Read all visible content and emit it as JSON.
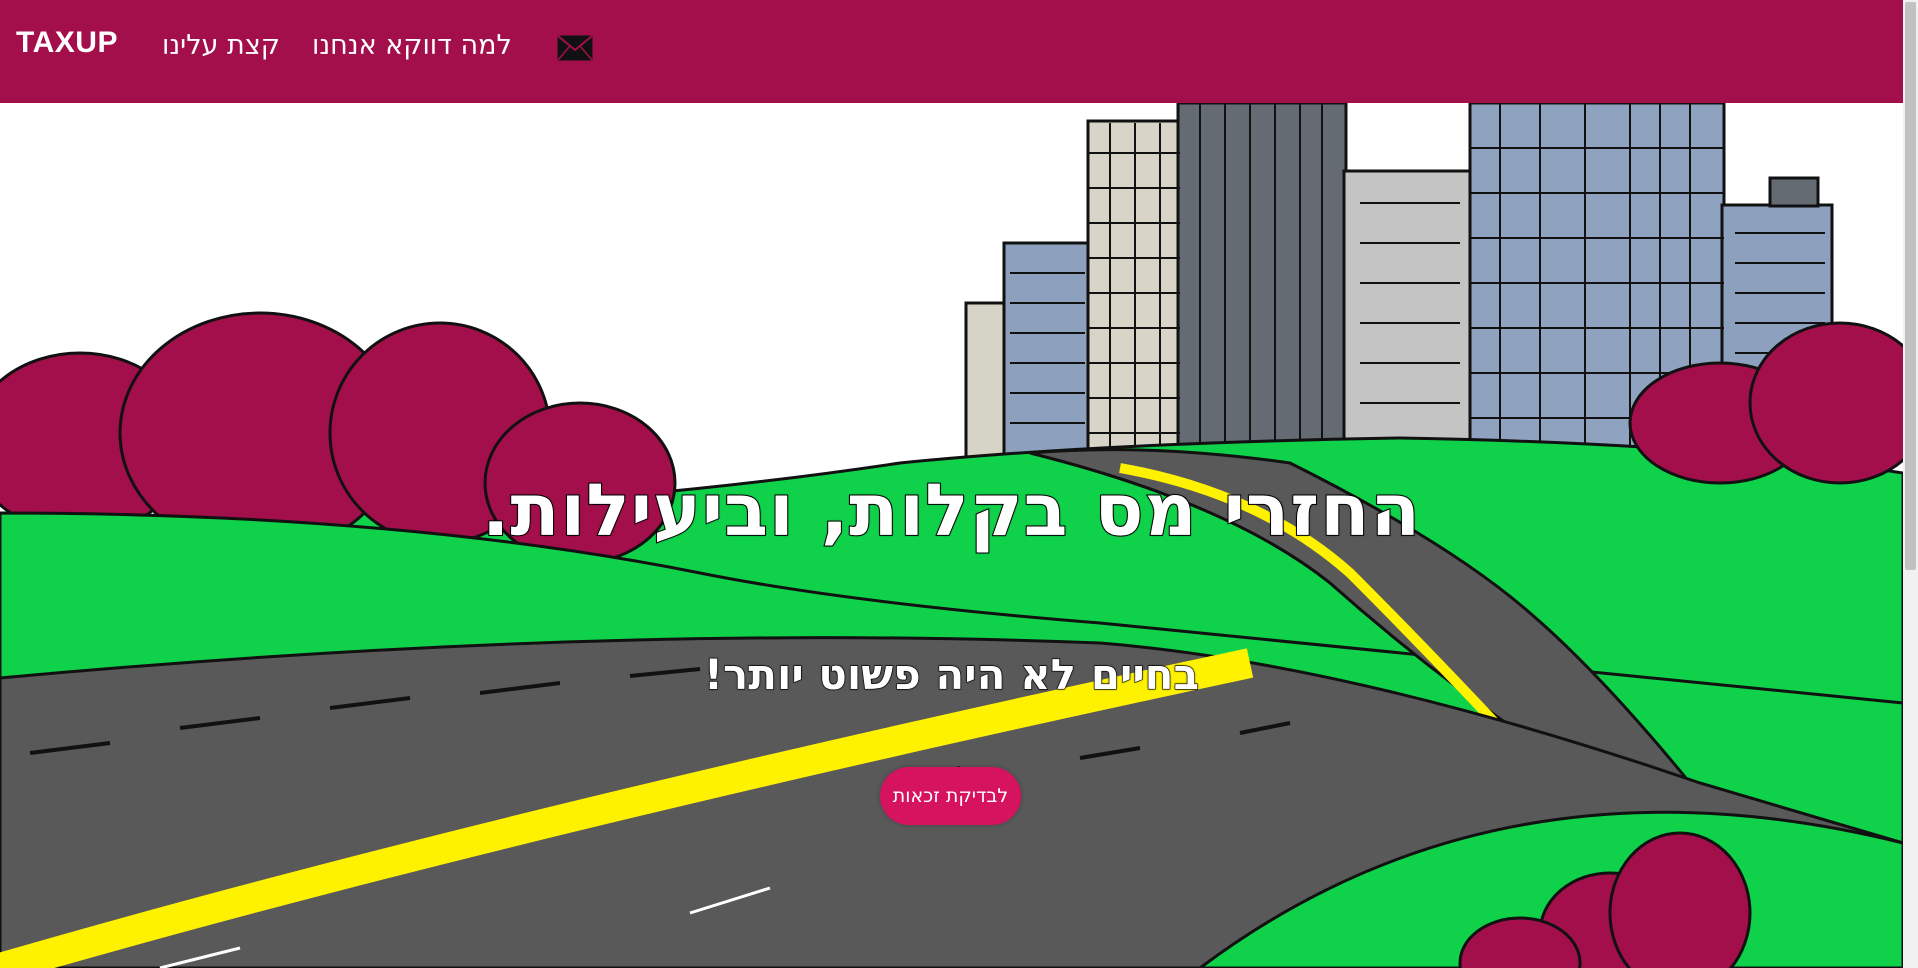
{
  "navbar": {
    "brand": "TAXUP",
    "links": [
      {
        "label": "קצת עלינו"
      },
      {
        "label": "למה דווקא אנחנו"
      }
    ],
    "contact_icon": "envelope-icon"
  },
  "hero": {
    "headline": "החזרי מס בקלות, וביעילות.",
    "subheadline": "בחיים לא היה פשוט יותר!",
    "cta_label": "לבדיקת זכאות"
  },
  "colors": {
    "navbar": "#a30f4b",
    "cta": "#d6135f",
    "grass": "#0fd24a",
    "bushes": "#a30f4b",
    "road": "#595959",
    "road_line": "#fff200"
  }
}
